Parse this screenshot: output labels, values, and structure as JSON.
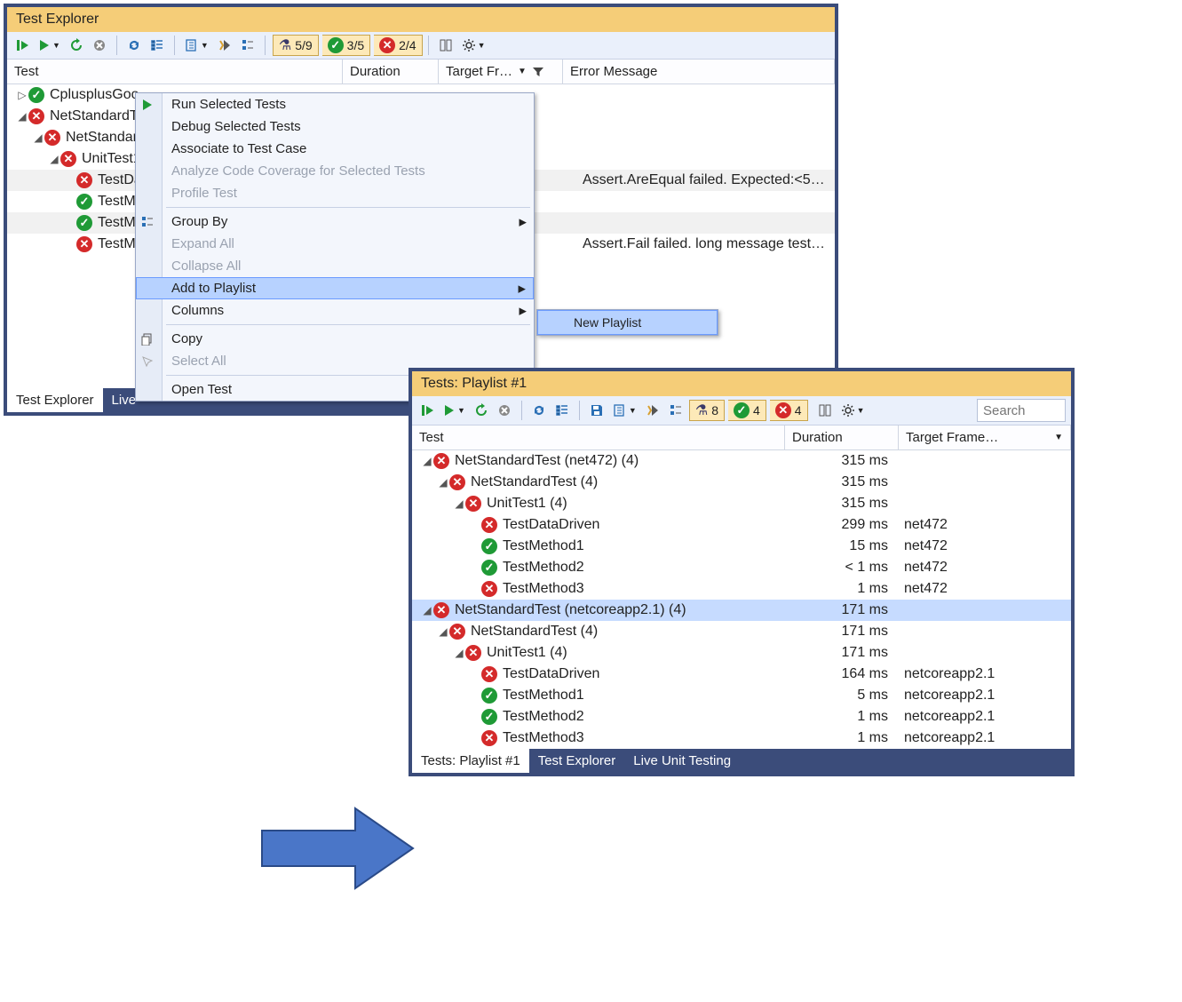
{
  "win1": {
    "title": "Test Explorer",
    "summary": {
      "flask": "5/9",
      "pass": "3/5",
      "fail": "2/4"
    },
    "columns": {
      "test": "Test",
      "duration": "Duration",
      "target": "Target Fr…",
      "error": "Error Message"
    },
    "tree": [
      {
        "indent": 0,
        "exp": "▷",
        "status": "pass",
        "label": "CplusplusGoo…"
      },
      {
        "indent": 0,
        "exp": "◢",
        "status": "fail",
        "label": "NetStandardT…"
      },
      {
        "indent": 1,
        "exp": "◢",
        "status": "fail",
        "label": "NetStandard…"
      },
      {
        "indent": 2,
        "exp": "◢",
        "status": "fail",
        "label": "UnitTest1"
      },
      {
        "indent": 3,
        "exp": "",
        "status": "fail",
        "label": "TestData…",
        "error": "Assert.AreEqual failed. Expected:<5…",
        "alt": true
      },
      {
        "indent": 3,
        "exp": "",
        "status": "pass",
        "label": "TestMet…"
      },
      {
        "indent": 3,
        "exp": "",
        "status": "pass",
        "label": "TestMet…",
        "alt": true
      },
      {
        "indent": 3,
        "exp": "",
        "status": "fail",
        "label": "TestMet…",
        "error": "Assert.Fail failed. long message test…"
      }
    ],
    "tabs": {
      "active": "Test Explorer",
      "other": "Live"
    }
  },
  "ctx": {
    "items": [
      {
        "label": "Run Selected Tests",
        "icon": "play"
      },
      {
        "label": "Debug Selected Tests"
      },
      {
        "label": "Associate to Test Case"
      },
      {
        "label": "Analyze Code Coverage for Selected Tests",
        "disabled": true
      },
      {
        "label": "Profile Test",
        "disabled": true
      },
      {
        "sep": true
      },
      {
        "label": "Group By",
        "icon": "group",
        "submenu": true
      },
      {
        "label": "Expand All",
        "disabled": true
      },
      {
        "label": "Collapse All",
        "disabled": true
      },
      {
        "label": "Add to Playlist",
        "submenu": true,
        "highlight": true
      },
      {
        "label": "Columns",
        "submenu": true
      },
      {
        "sep": true
      },
      {
        "label": "Copy",
        "icon": "copy"
      },
      {
        "label": "Select All",
        "disabled": true,
        "icon": "select"
      },
      {
        "sep": true
      },
      {
        "label": "Open Test"
      }
    ],
    "submenu_label": "New Playlist"
  },
  "win2": {
    "title": "Tests: Playlist #1",
    "summary": {
      "flask": "8",
      "pass": "4",
      "fail": "4"
    },
    "search_placeholder": "Search",
    "columns": {
      "test": "Test",
      "duration": "Duration",
      "target": "Target Frame…"
    },
    "tree": [
      {
        "indent": 0,
        "exp": "◢",
        "status": "fail",
        "label": "NetStandardTest (net472)  (4)",
        "dur": "315 ms"
      },
      {
        "indent": 1,
        "exp": "◢",
        "status": "fail",
        "label": "NetStandardTest  (4)",
        "dur": "315 ms"
      },
      {
        "indent": 2,
        "exp": "◢",
        "status": "fail",
        "label": "UnitTest1  (4)",
        "dur": "315 ms"
      },
      {
        "indent": 3,
        "exp": "",
        "status": "fail",
        "label": "TestDataDriven",
        "dur": "299 ms",
        "tgt": "net472"
      },
      {
        "indent": 3,
        "exp": "",
        "status": "pass",
        "label": "TestMethod1",
        "dur": "15 ms",
        "tgt": "net472"
      },
      {
        "indent": 3,
        "exp": "",
        "status": "pass",
        "label": "TestMethod2",
        "dur": "< 1 ms",
        "tgt": "net472"
      },
      {
        "indent": 3,
        "exp": "",
        "status": "fail",
        "label": "TestMethod3",
        "dur": "1 ms",
        "tgt": "net472"
      },
      {
        "indent": 0,
        "exp": "◢",
        "status": "fail",
        "label": "NetStandardTest (netcoreapp2.1)  (4)",
        "dur": "171 ms",
        "sel": true
      },
      {
        "indent": 1,
        "exp": "◢",
        "status": "fail",
        "label": "NetStandardTest  (4)",
        "dur": "171 ms"
      },
      {
        "indent": 2,
        "exp": "◢",
        "status": "fail",
        "label": "UnitTest1  (4)",
        "dur": "171 ms"
      },
      {
        "indent": 3,
        "exp": "",
        "status": "fail",
        "label": "TestDataDriven",
        "dur": "164 ms",
        "tgt": "netcoreapp2.1"
      },
      {
        "indent": 3,
        "exp": "",
        "status": "pass",
        "label": "TestMethod1",
        "dur": "5 ms",
        "tgt": "netcoreapp2.1"
      },
      {
        "indent": 3,
        "exp": "",
        "status": "pass",
        "label": "TestMethod2",
        "dur": "1 ms",
        "tgt": "netcoreapp2.1"
      },
      {
        "indent": 3,
        "exp": "",
        "status": "fail",
        "label": "TestMethod3",
        "dur": "1 ms",
        "tgt": "netcoreapp2.1"
      }
    ],
    "tabs": {
      "active": "Tests: Playlist #1",
      "t2": "Test Explorer",
      "t3": "Live Unit Testing"
    }
  }
}
